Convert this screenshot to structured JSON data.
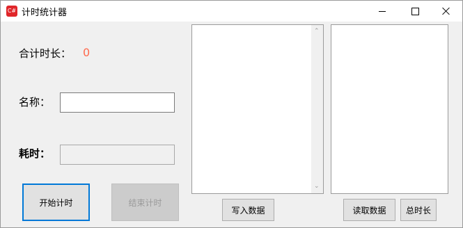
{
  "window": {
    "title": "计时统计器",
    "icon_text": "C#",
    "controls": [
      "minimize-icon",
      "maximize-icon",
      "close-icon"
    ]
  },
  "form": {
    "total_label": "合计时长：",
    "total_value": "0",
    "name_label": "名称：",
    "name_value": "",
    "elapsed_label": "耗时：",
    "elapsed_value": ""
  },
  "buttons": {
    "start": "开始计时",
    "end": "结束计时",
    "write": "写入数据",
    "read": "读取数据",
    "total": "总时长"
  },
  "lists": {
    "left_items": [],
    "right_items": []
  },
  "colors": {
    "accent": "#0078d7",
    "total_value": "#ff6a4d"
  }
}
